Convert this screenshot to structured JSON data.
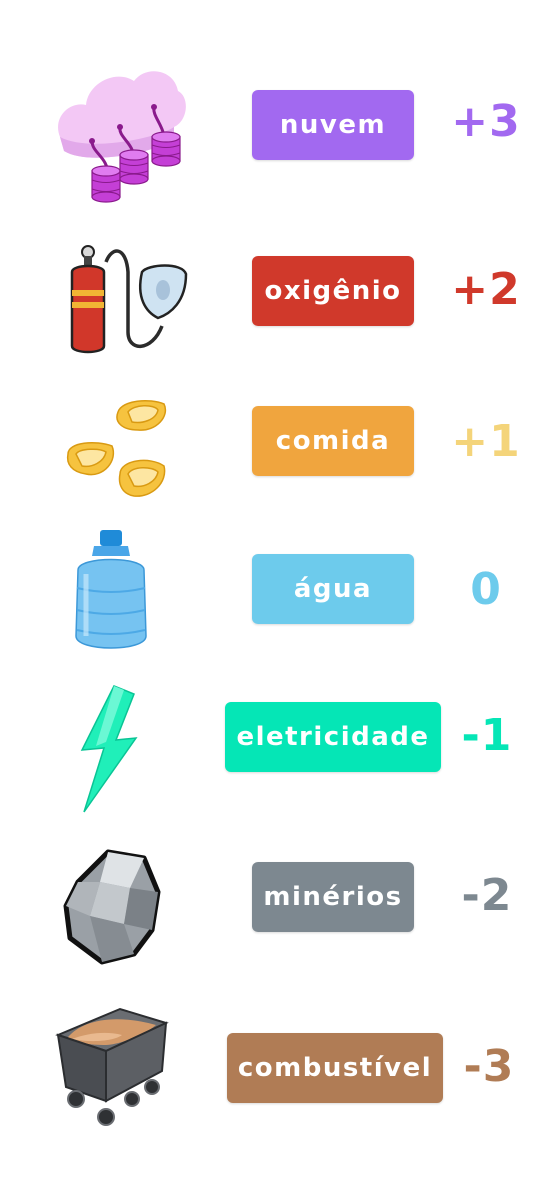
{
  "resources": [
    {
      "label": "nuvem",
      "score": "+3",
      "icon": "cloud-database-icon",
      "color": "#a269f0",
      "score_color": "#a269f0"
    },
    {
      "label": "oxigênio",
      "score": "+2",
      "icon": "oxygen-tank-icon",
      "color": "#d0392b",
      "score_color": "#d0392b"
    },
    {
      "label": "comida",
      "score": "+1",
      "icon": "food-nuggets-icon",
      "color": "#f0a53e",
      "score_color": "#f4d47a"
    },
    {
      "label": "água",
      "score": "0",
      "icon": "water-jug-icon",
      "color": "#6dcbec",
      "score_color": "#6dcbec"
    },
    {
      "label": "eletricidade",
      "score": "-1",
      "icon": "lightning-bolt-icon",
      "color": "#05e6b6",
      "score_color": "#05e6b6"
    },
    {
      "label": "minérios",
      "score": "-2",
      "icon": "ore-rock-icon",
      "color": "#7d8890",
      "score_color": "#7d8890"
    },
    {
      "label": "combustível",
      "score": "-3",
      "icon": "mine-cart-icon",
      "color": "#b07c55",
      "score_color": "#b07c55"
    }
  ]
}
